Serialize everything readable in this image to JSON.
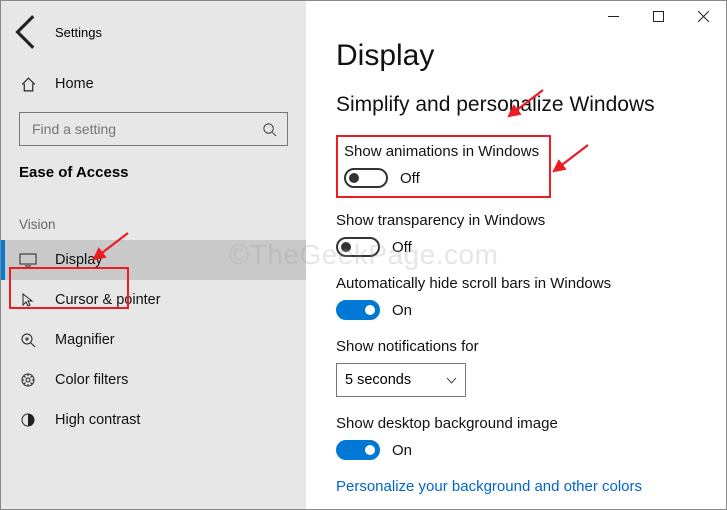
{
  "window": {
    "title": "Settings"
  },
  "sidebar": {
    "home": "Home",
    "search_placeholder": "Find a setting",
    "section": "Ease of Access",
    "group": "Vision",
    "items": [
      {
        "label": "Display",
        "icon": "display-icon",
        "selected": true
      },
      {
        "label": "Cursor & pointer",
        "icon": "cursor-icon"
      },
      {
        "label": "Magnifier",
        "icon": "magnifier-icon"
      },
      {
        "label": "Color filters",
        "icon": "color-filters-icon"
      },
      {
        "label": "High contrast",
        "icon": "contrast-icon"
      }
    ]
  },
  "main": {
    "title": "Display",
    "subtitle": "Simplify and personalize Windows",
    "settings": {
      "animations": {
        "label": "Show animations in Windows",
        "state": "Off",
        "on": false
      },
      "transparency": {
        "label": "Show transparency in Windows",
        "state": "Off",
        "on": false
      },
      "scrollbars": {
        "label": "Automatically hide scroll bars in Windows",
        "state": "On",
        "on": true
      },
      "notifications": {
        "label": "Show notifications for",
        "value": "5 seconds"
      },
      "background": {
        "label": "Show desktop background image",
        "state": "On",
        "on": true
      },
      "link": "Personalize your background and other colors"
    }
  },
  "watermark": "©TheGeekPage.com"
}
